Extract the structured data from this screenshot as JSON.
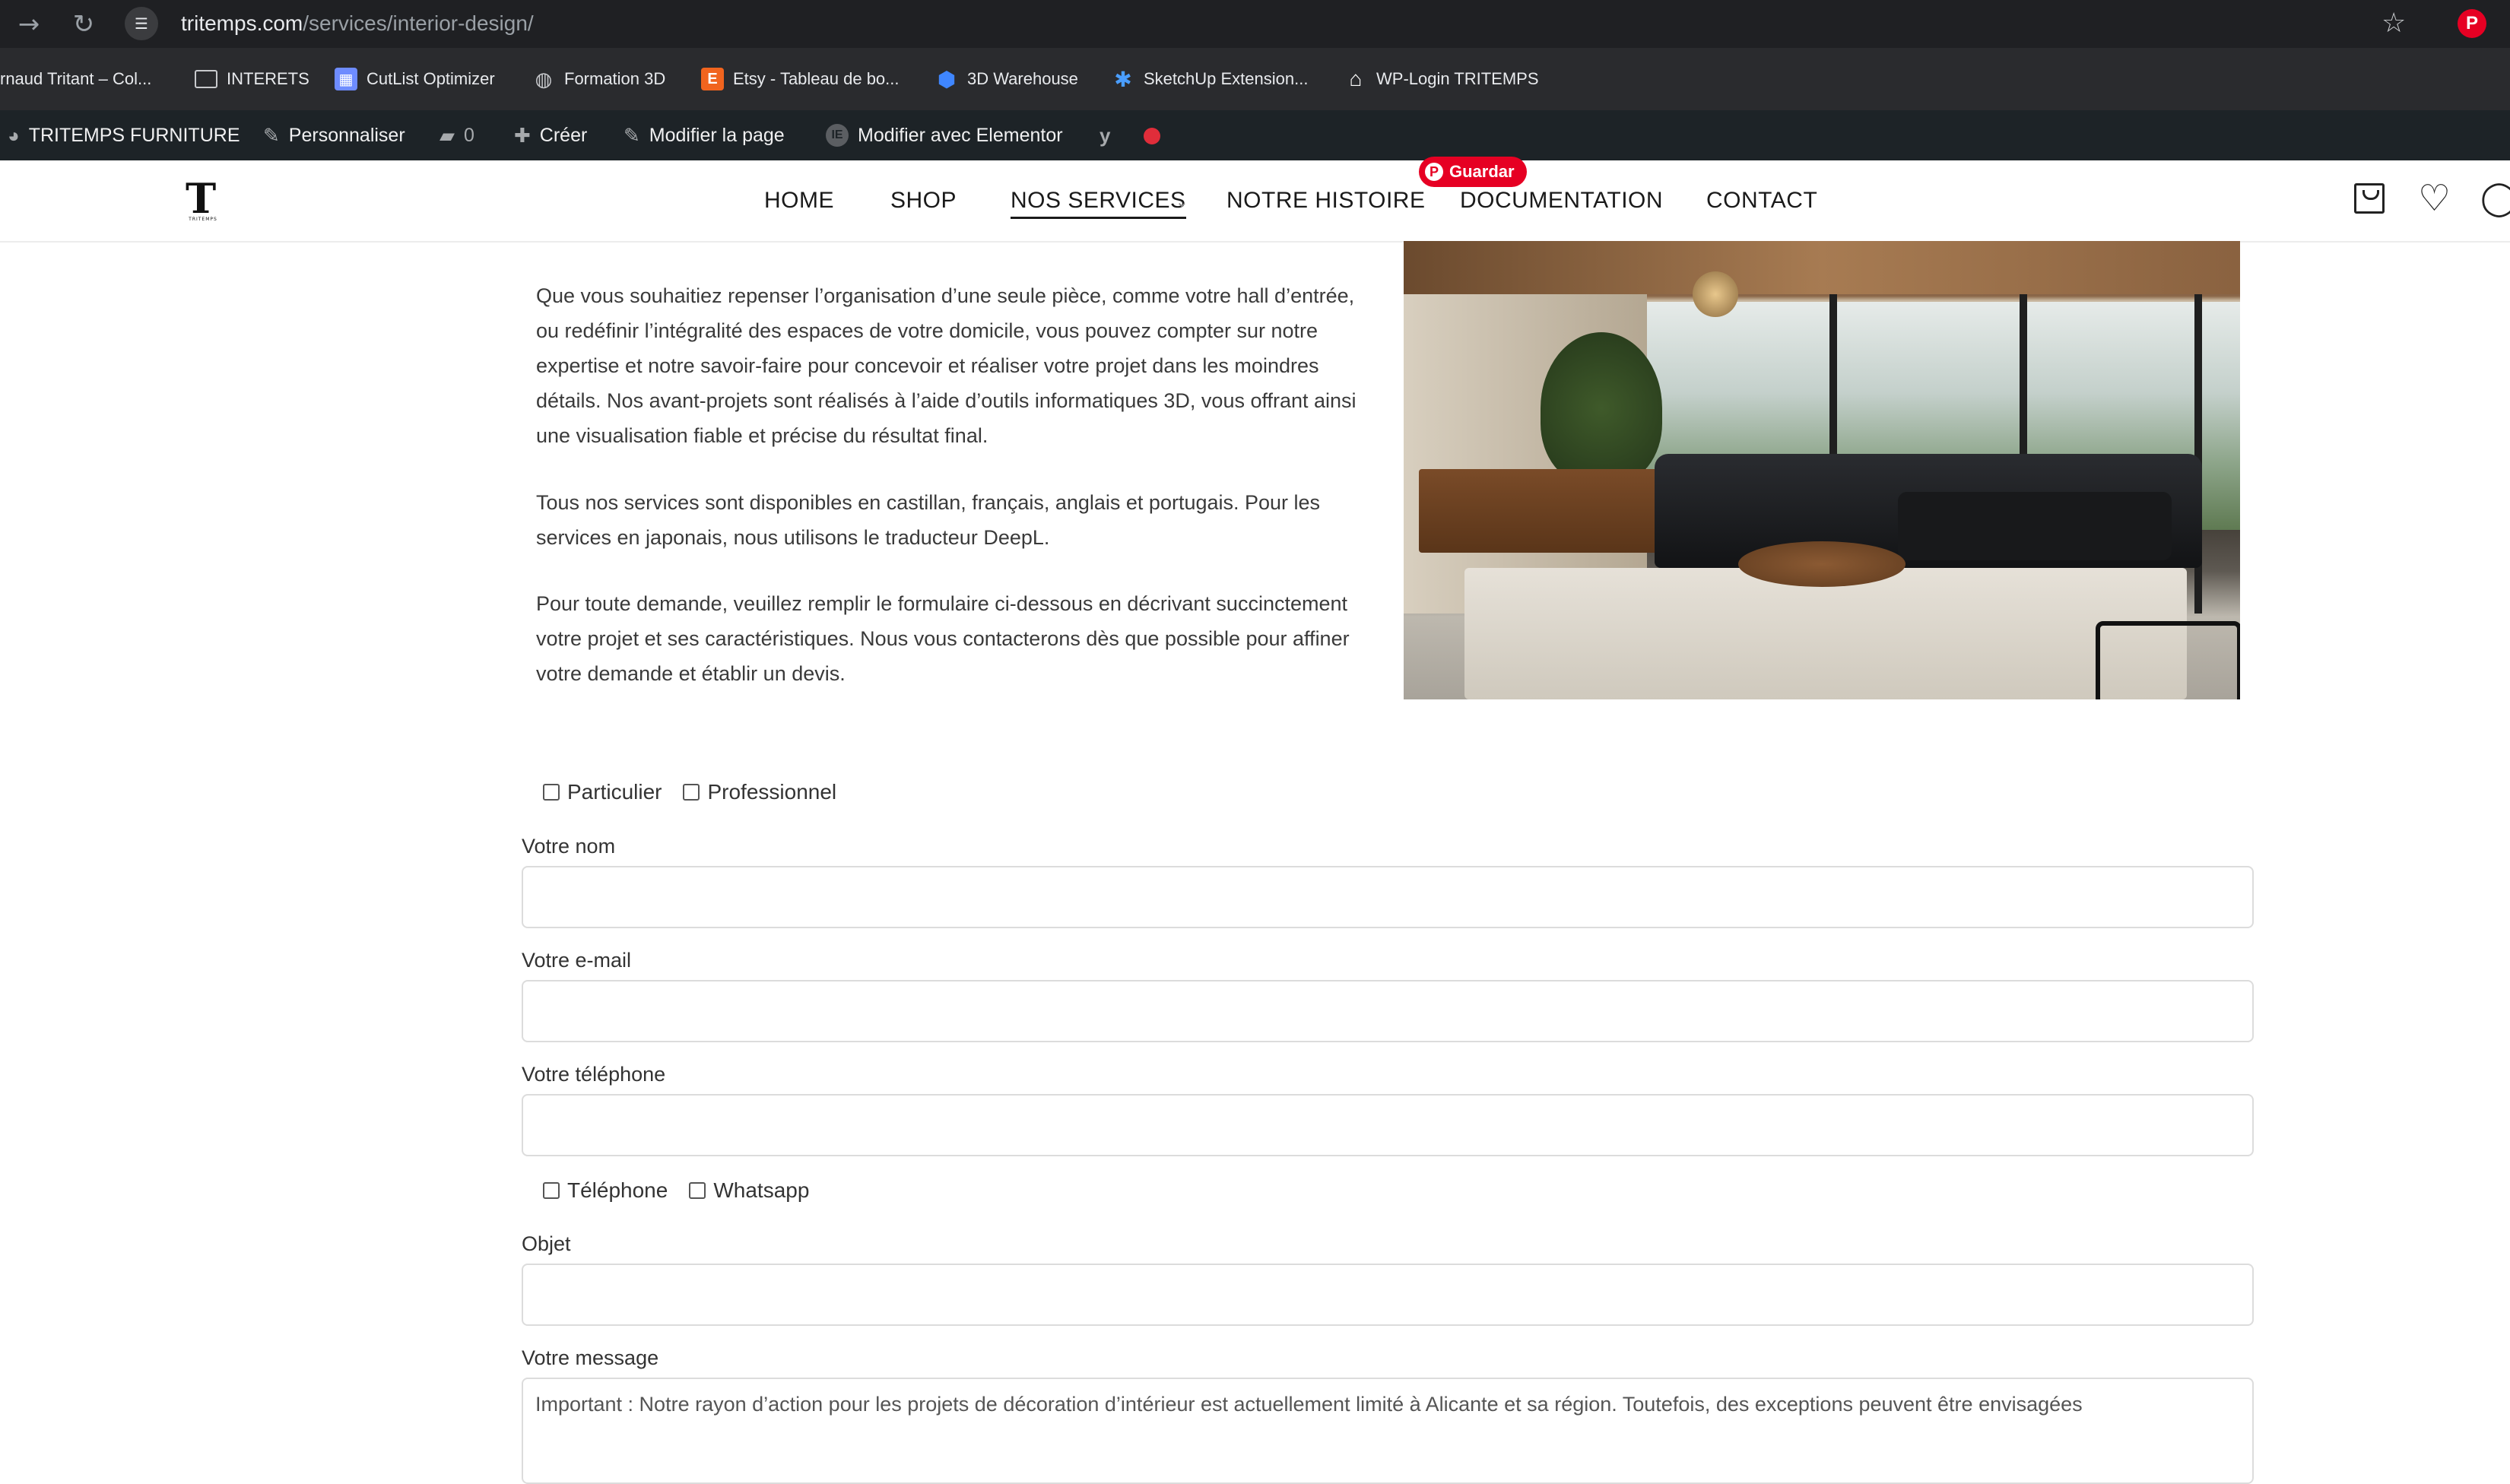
{
  "browser": {
    "url_domain": "tritemps.com",
    "url_path": "/services/interior-design/",
    "bookmarks": [
      {
        "label": "rnaud Tritant – Col...",
        "icon": "page-icon"
      },
      {
        "label": "INTERETS",
        "icon": "folder-icon"
      },
      {
        "label": "CutList Optimizer",
        "icon": "cutlist-icon"
      },
      {
        "label": "Formation 3D",
        "icon": "globe-icon"
      },
      {
        "label": "Etsy - Tableau de bo...",
        "icon": "etsy-icon"
      },
      {
        "label": "3D Warehouse",
        "icon": "warehouse-icon"
      },
      {
        "label": "SketchUp Extension...",
        "icon": "sketchup-icon"
      },
      {
        "label": "WP-Login TRITEMPS",
        "icon": "wp-login-icon"
      }
    ],
    "etsy_letter": "E"
  },
  "wp_admin": {
    "site_name": "TRITEMPS FURNITURE",
    "customize": "Personnaliser",
    "comments_count": "0",
    "create": "Créer",
    "edit_page": "Modifier la page",
    "edit_elementor": "Modifier avec Elementor"
  },
  "header": {
    "logo_letter": "T",
    "logo_sub": "TRITEMPS",
    "menu": [
      "HOME",
      "SHOP",
      "NOS SERVICES",
      "NOTRE HISTOIRE",
      "DOCUMENTATION",
      "CONTACT"
    ],
    "pinterest_save": "Guardar",
    "pinterest_letter": "P"
  },
  "content": {
    "paragraphs": [
      "Que vous souhaitiez repenser l’organisation d’une seule pièce, comme votre hall d’entrée, ou redéfinir l’intégralité des espaces de votre domicile, vous pouvez compter sur notre expertise et notre savoir-faire pour concevoir et réaliser votre projet dans les moindres détails. Nos avant-projets sont réalisés à l’aide d’outils informatiques 3D, vous offrant ainsi une visualisation fiable et précise du résultat final.",
      "Tous nos services sont disponibles en castillan, français, anglais et portugais. Pour les services en japonais, nous utilisons le traducteur DeepL.",
      "Pour toute demande, veuillez remplir le formulaire ci-dessous en décrivant succinctement votre projet et ses caractéristiques. Nous vous contacterons dès que possible pour affiner votre demande et établir un devis."
    ]
  },
  "form": {
    "client_type": [
      "Particulier",
      "Professionnel"
    ],
    "name_label": "Votre nom",
    "email_label": "Votre e-mail",
    "phone_label": "Votre téléphone",
    "contact_pref": [
      "Téléphone",
      "Whatsapp"
    ],
    "subject_label": "Objet",
    "message_label": "Votre message",
    "message_placeholder": "Important : Notre rayon d’action pour les projets de décoration d’intérieur est actuellement limité à Alicante et sa région. Toutefois, des exceptions peuvent être envisagées"
  }
}
